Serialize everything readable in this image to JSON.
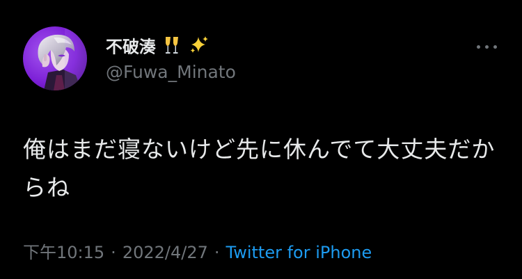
{
  "user": {
    "display_name": "不破湊",
    "handle": "@Fuwa_Minato",
    "avatar_icon": "avatar-image",
    "name_emojis": [
      "champagne-glasses-icon",
      "sparkles-icon"
    ]
  },
  "more_icon": "more-horizontal-icon",
  "tweet": {
    "text": "俺はまだ寝ないけど先に休んでて大丈夫だからね"
  },
  "meta": {
    "time": "下午10:15",
    "date": "2022/4/27",
    "separator": "·",
    "source": "Twitter for iPhone"
  },
  "colors": {
    "background": "#000000",
    "primary_text": "#e7e9ea",
    "secondary_text": "#71767b",
    "link": "#1d9bf0",
    "avatar_bg": "#7b1fd6"
  }
}
